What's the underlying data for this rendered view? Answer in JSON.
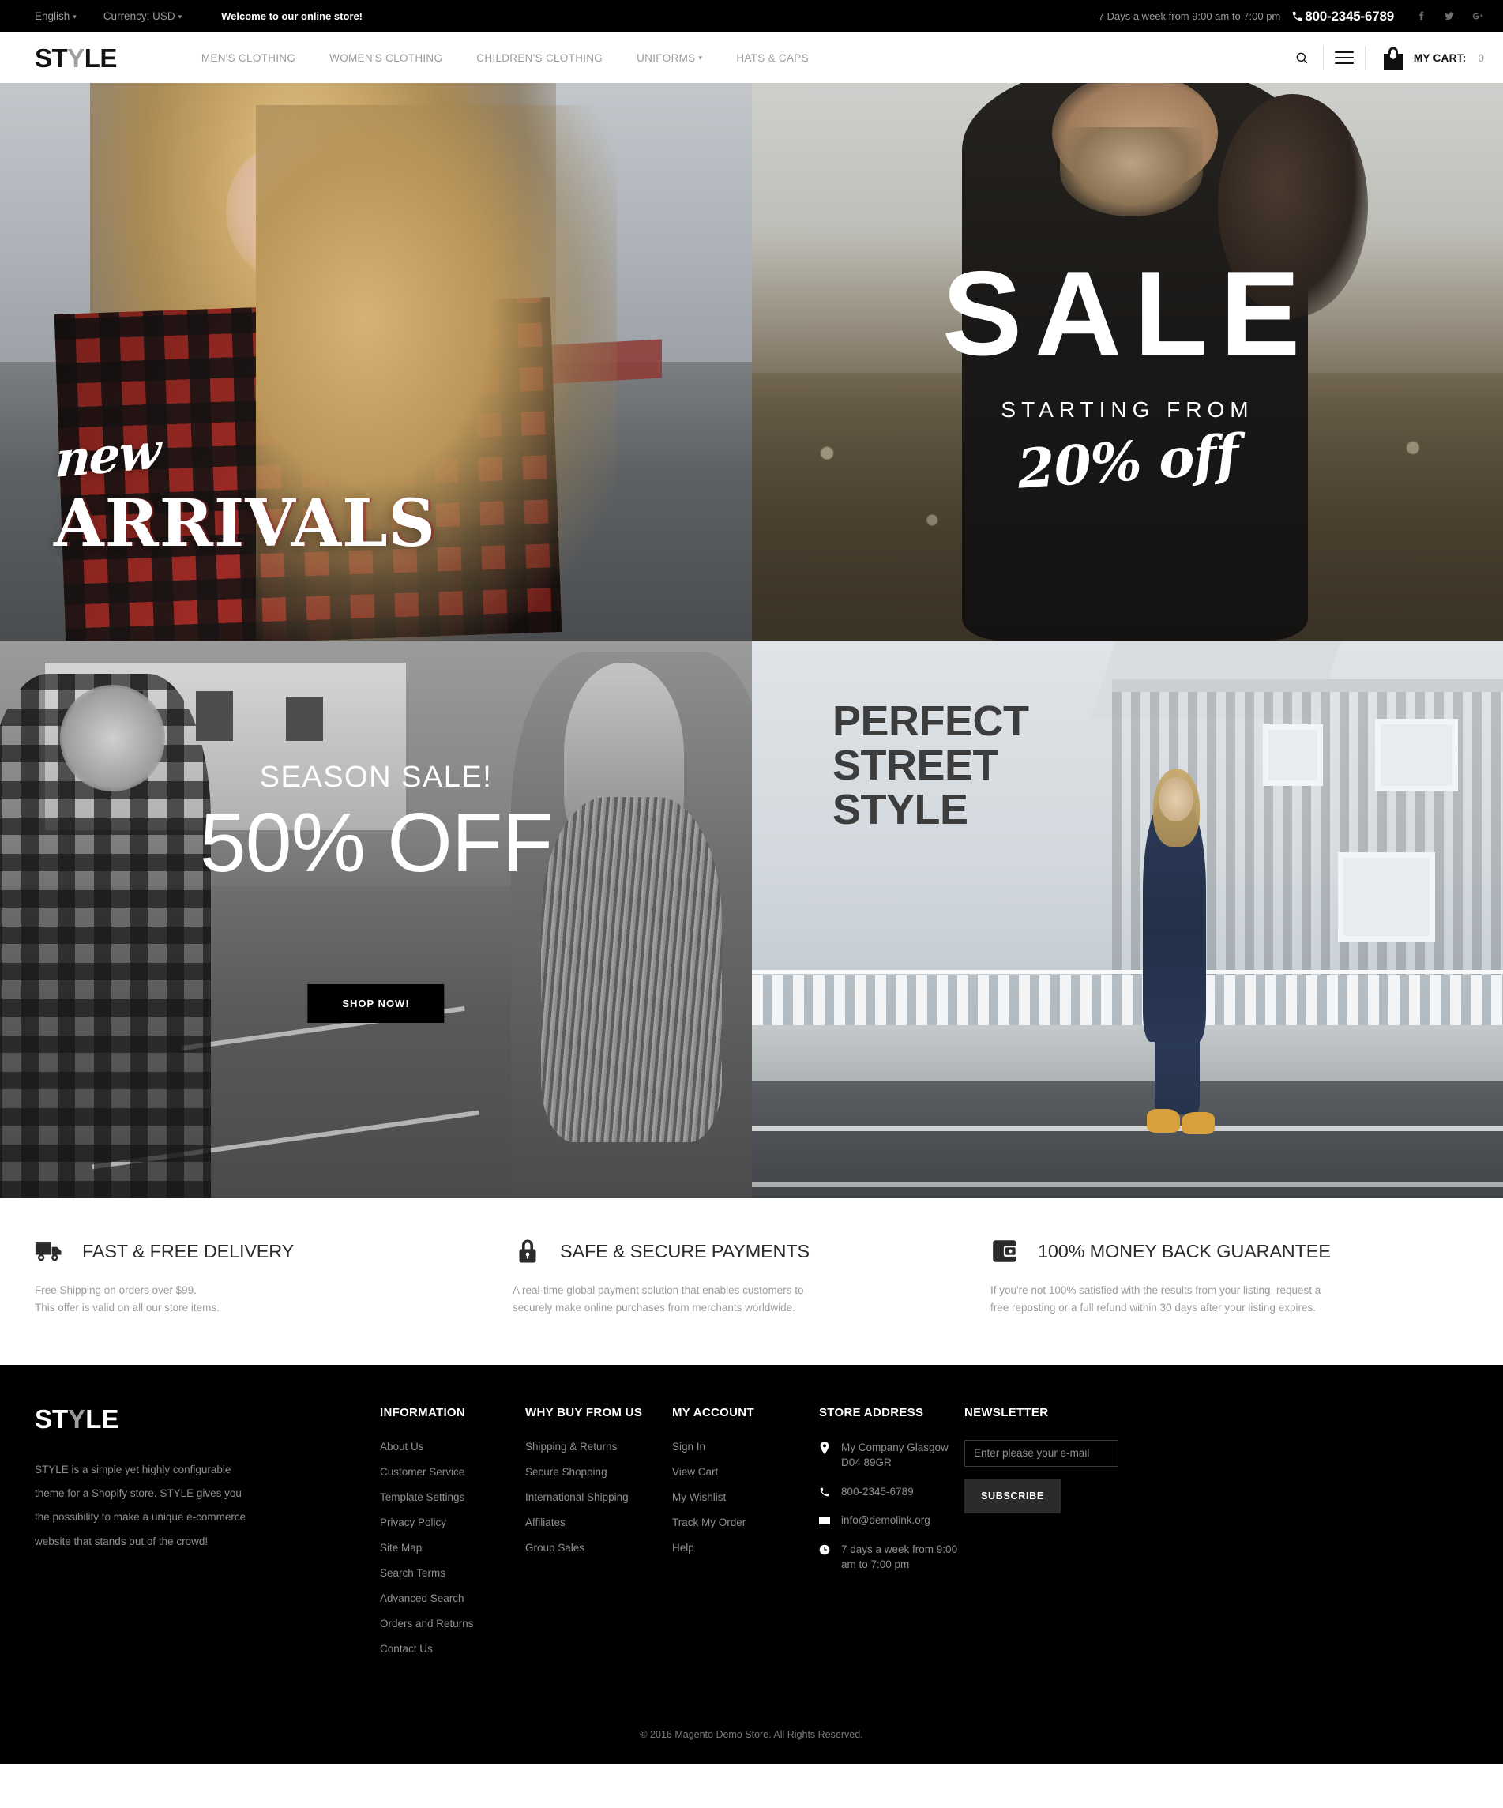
{
  "topbar": {
    "language": "English",
    "currency": "Currency: USD",
    "welcome": "Welcome to our online store!",
    "hours": "7 Days a week from 9:00 am to 7:00 pm",
    "phone": "800-2345-6789",
    "socials": [
      "facebook-icon",
      "twitter-icon",
      "google-plus-icon"
    ]
  },
  "header": {
    "logo_first": "ST",
    "logo_accent": "Y",
    "logo_last": "LE",
    "nav": [
      {
        "label": "MEN'S CLOTHING",
        "has_caret": false
      },
      {
        "label": "WOMEN'S CLOTHING",
        "has_caret": false
      },
      {
        "label": "CHILDREN'S CLOTHING",
        "has_caret": false
      },
      {
        "label": "UNIFORMS",
        "has_caret": true
      },
      {
        "label": "HATS & CAPS",
        "has_caret": false
      }
    ],
    "cart_label": "MY CART:",
    "cart_count": "0"
  },
  "banners": {
    "new_arrivals": {
      "script": "new",
      "headline": "ARRIVALS"
    },
    "sale": {
      "headline": "SALE",
      "sub": "STARTING FROM",
      "offer": "20% off"
    },
    "season": {
      "title": "SEASON SALE!",
      "percent": "50% OFF",
      "button": "SHOP NOW!"
    },
    "street": {
      "line1": "PERFECT",
      "line2": "STREET",
      "line3": "STYLE"
    }
  },
  "features": [
    {
      "icon": "truck-icon",
      "title": "FAST & FREE DELIVERY",
      "desc": "Free Shipping on orders over $99.\nThis offer is valid on all our store items."
    },
    {
      "icon": "lock-icon",
      "title": "SAFE & SECURE PAYMENTS",
      "desc": "A real-time global payment solution that enables customers to\nsecurely make online purchases from merchants worldwide."
    },
    {
      "icon": "wallet-icon",
      "title": "100% MONEY BACK GUARANTEE",
      "desc": "If you're not 100% satisfied with the results from your listing, request a\nfree reposting or a full refund within 30 days after your listing expires."
    }
  ],
  "footer": {
    "logo_first": "ST",
    "logo_accent": "Y",
    "logo_last": "LE",
    "about": "STYLE is a simple yet highly configurable theme for a Shopify store. STYLE gives you the possibility to make a unique e-commerce website that stands out of the crowd!",
    "columns": [
      {
        "title": "INFORMATION",
        "links": [
          "About Us",
          "Customer Service",
          "Template Settings",
          "Privacy Policy",
          "Site Map",
          "Search Terms",
          "Advanced Search",
          "Orders and Returns",
          "Contact Us"
        ]
      },
      {
        "title": "WHY BUY FROM US",
        "links": [
          "Shipping & Returns",
          "Secure Shopping",
          "International Shipping",
          "Affiliates",
          "Group Sales"
        ]
      },
      {
        "title": "MY ACCOUNT",
        "links": [
          "Sign In",
          "View Cart",
          "My Wishlist",
          "Track My Order",
          "Help"
        ]
      }
    ],
    "store_address": {
      "title": "STORE ADDRESS",
      "address": "My Company Glasgow D04 89GR",
      "phone": "800-2345-6789",
      "email": "info@demolink.org",
      "hours": "7 days a week from 9:00 am to 7:00 pm"
    },
    "newsletter": {
      "title": "NEWSLETTER",
      "placeholder": "Enter please your e-mail",
      "value": "",
      "button": "SUBSCRIBE"
    },
    "copyright": "© 2016 Magento Demo Store. All Rights Reserved."
  },
  "colors": {
    "accent_dark": "#000000",
    "muted": "#9b9b9b",
    "street_text": "#3c3c3c"
  }
}
